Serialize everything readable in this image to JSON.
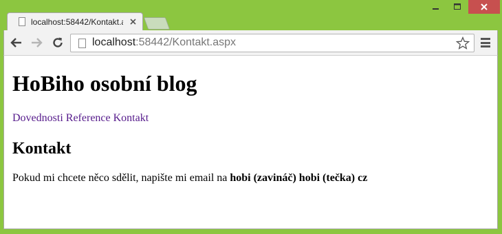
{
  "browser": {
    "tab_title": "localhost:58442/Kontakt.aspx",
    "url_host": "localhost",
    "url_rest": ":58442/Kontakt.aspx"
  },
  "page": {
    "heading": "HoBiho osobní blog",
    "nav": [
      "Dovednosti",
      "Reference",
      "Kontakt"
    ],
    "subheading": "Kontakt",
    "paragraph_text": "Pokud mi chcete něco sdělit, napište mi email na ",
    "paragraph_email": "hobi (zavináč) hobi (tečka) cz"
  },
  "colors": {
    "frame": "#8cc640",
    "close_button": "#c7504f",
    "link_visited": "#551a8b"
  }
}
